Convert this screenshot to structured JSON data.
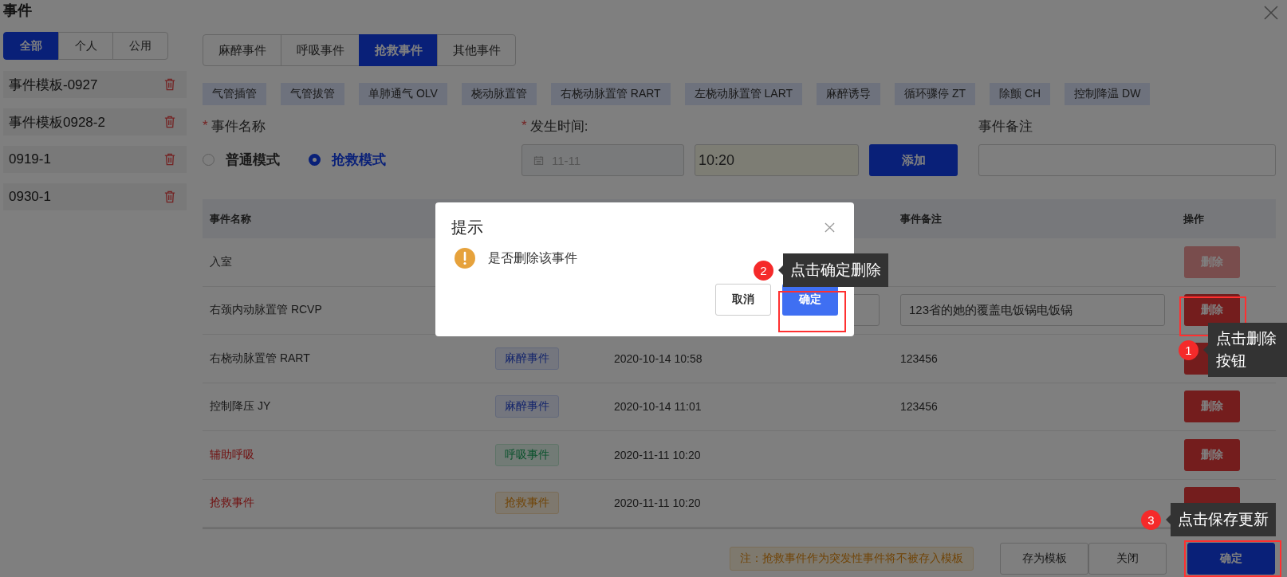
{
  "window": {
    "title": "事件"
  },
  "scope_tabs": [
    {
      "label": "全部",
      "selected": true
    },
    {
      "label": "个人",
      "selected": false
    },
    {
      "label": "公用",
      "selected": false
    }
  ],
  "templates": [
    {
      "name": "事件模板-0927"
    },
    {
      "name": "事件模板0928-2"
    },
    {
      "name": "0919-1"
    },
    {
      "name": "0930-1"
    }
  ],
  "category_tabs": [
    {
      "label": "麻醉事件",
      "selected": false
    },
    {
      "label": "呼吸事件",
      "selected": false
    },
    {
      "label": "抢救事件",
      "selected": true
    },
    {
      "label": "其他事件",
      "selected": false
    }
  ],
  "quick_tags": [
    "气管插管",
    "气管拔管",
    "单肺通气 OLV",
    "桡动脉置管",
    "右桡动脉置管 RART",
    "左桡动脉置管 LART",
    "麻醉诱导",
    "循环骤停 ZT",
    "除颤 CH",
    "控制降温 DW"
  ],
  "form": {
    "required_mark": "*",
    "name_label": "事件名称",
    "modes": [
      {
        "label": "普通模式",
        "selected": false
      },
      {
        "label": "抢救模式",
        "selected": true
      }
    ],
    "time_label": "发生时间:",
    "date": {
      "value": "11-11",
      "disabled": true
    },
    "time": {
      "value": "10:20"
    },
    "add_button": "添加",
    "remark_label": "事件备注"
  },
  "table": {
    "columns": {
      "name": "事件名称",
      "remark": "事件备注",
      "action": "操作"
    },
    "rows": [
      {
        "kind": "plain",
        "name": "入室",
        "highlight": false,
        "delete": {
          "label": "删除",
          "disabled": true
        }
      },
      {
        "kind": "edit",
        "name": "右颈内动脉置管 RCVP",
        "highlight": false,
        "remark": "123省的她的覆盖电饭锅电饭锅",
        "delete": {
          "label": "删除",
          "disabled": false
        }
      },
      {
        "kind": "plain",
        "name": "右桡动脉置管 RART",
        "highlight": false,
        "tag": {
          "label": "麻醉事件",
          "kind": "anesthesia"
        },
        "time": "2020-10-14 10:58",
        "remark": "123456",
        "delete": {
          "disabled": false
        }
      },
      {
        "kind": "plain",
        "name": "控制降压 JY",
        "highlight": false,
        "tag": {
          "label": "麻醉事件",
          "kind": "anesthesia"
        },
        "time": "2020-10-14 11:01",
        "remark": "123456",
        "delete": {
          "label": "删除",
          "disabled": false
        }
      },
      {
        "kind": "plain",
        "name": "辅助呼吸",
        "highlight": true,
        "tag": {
          "label": "呼吸事件",
          "kind": "respiratory"
        },
        "time": "2020-11-11 10:20",
        "delete": {
          "label": "删除",
          "disabled": false
        }
      },
      {
        "kind": "plain",
        "name": "抢救事件",
        "highlight": true,
        "tag": {
          "label": "抢救事件",
          "kind": "rescue"
        },
        "time": "2020-11-11 10:20",
        "delete": {
          "disabled": false
        }
      }
    ]
  },
  "footer": {
    "note": "注：抢救事件作为突发性事件将不被存入模板",
    "buttons": [
      {
        "label": "存为模板",
        "kind": "default"
      },
      {
        "label": "关闭",
        "kind": "default"
      },
      {
        "label": "确定",
        "kind": "primary"
      }
    ]
  },
  "dialog": {
    "title": "提示",
    "message": "是否删除该事件",
    "cancel": "取消",
    "confirm": "确定"
  },
  "callouts": [
    {
      "number": "1",
      "text": "点击删除按钮"
    },
    {
      "number": "2",
      "text": "点击确定删除"
    },
    {
      "number": "3",
      "text": "点击保存更新"
    }
  ]
}
